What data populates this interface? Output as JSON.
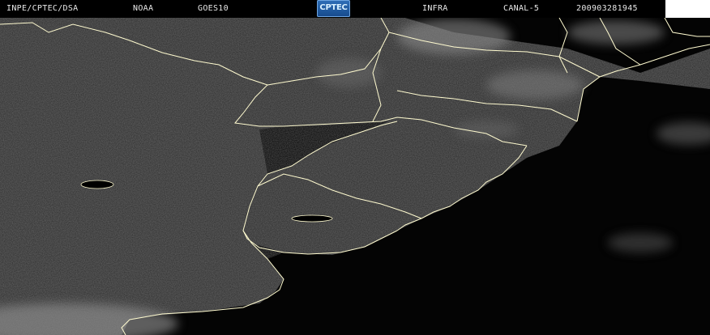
{
  "header": {
    "source": "INPE/CPTEC/DSA",
    "agency": "NOAA",
    "satellite": "GOES10",
    "logo_text": "CPTEC",
    "channel_type": "INFRA",
    "channel": "CANAL-5",
    "timestamp": "200903281945"
  },
  "colors": {
    "background": "#000000",
    "ocean": "#050505",
    "land": "#2b2b2b",
    "border_line": "#fffbd0",
    "cloud": "#9a9a9a"
  }
}
